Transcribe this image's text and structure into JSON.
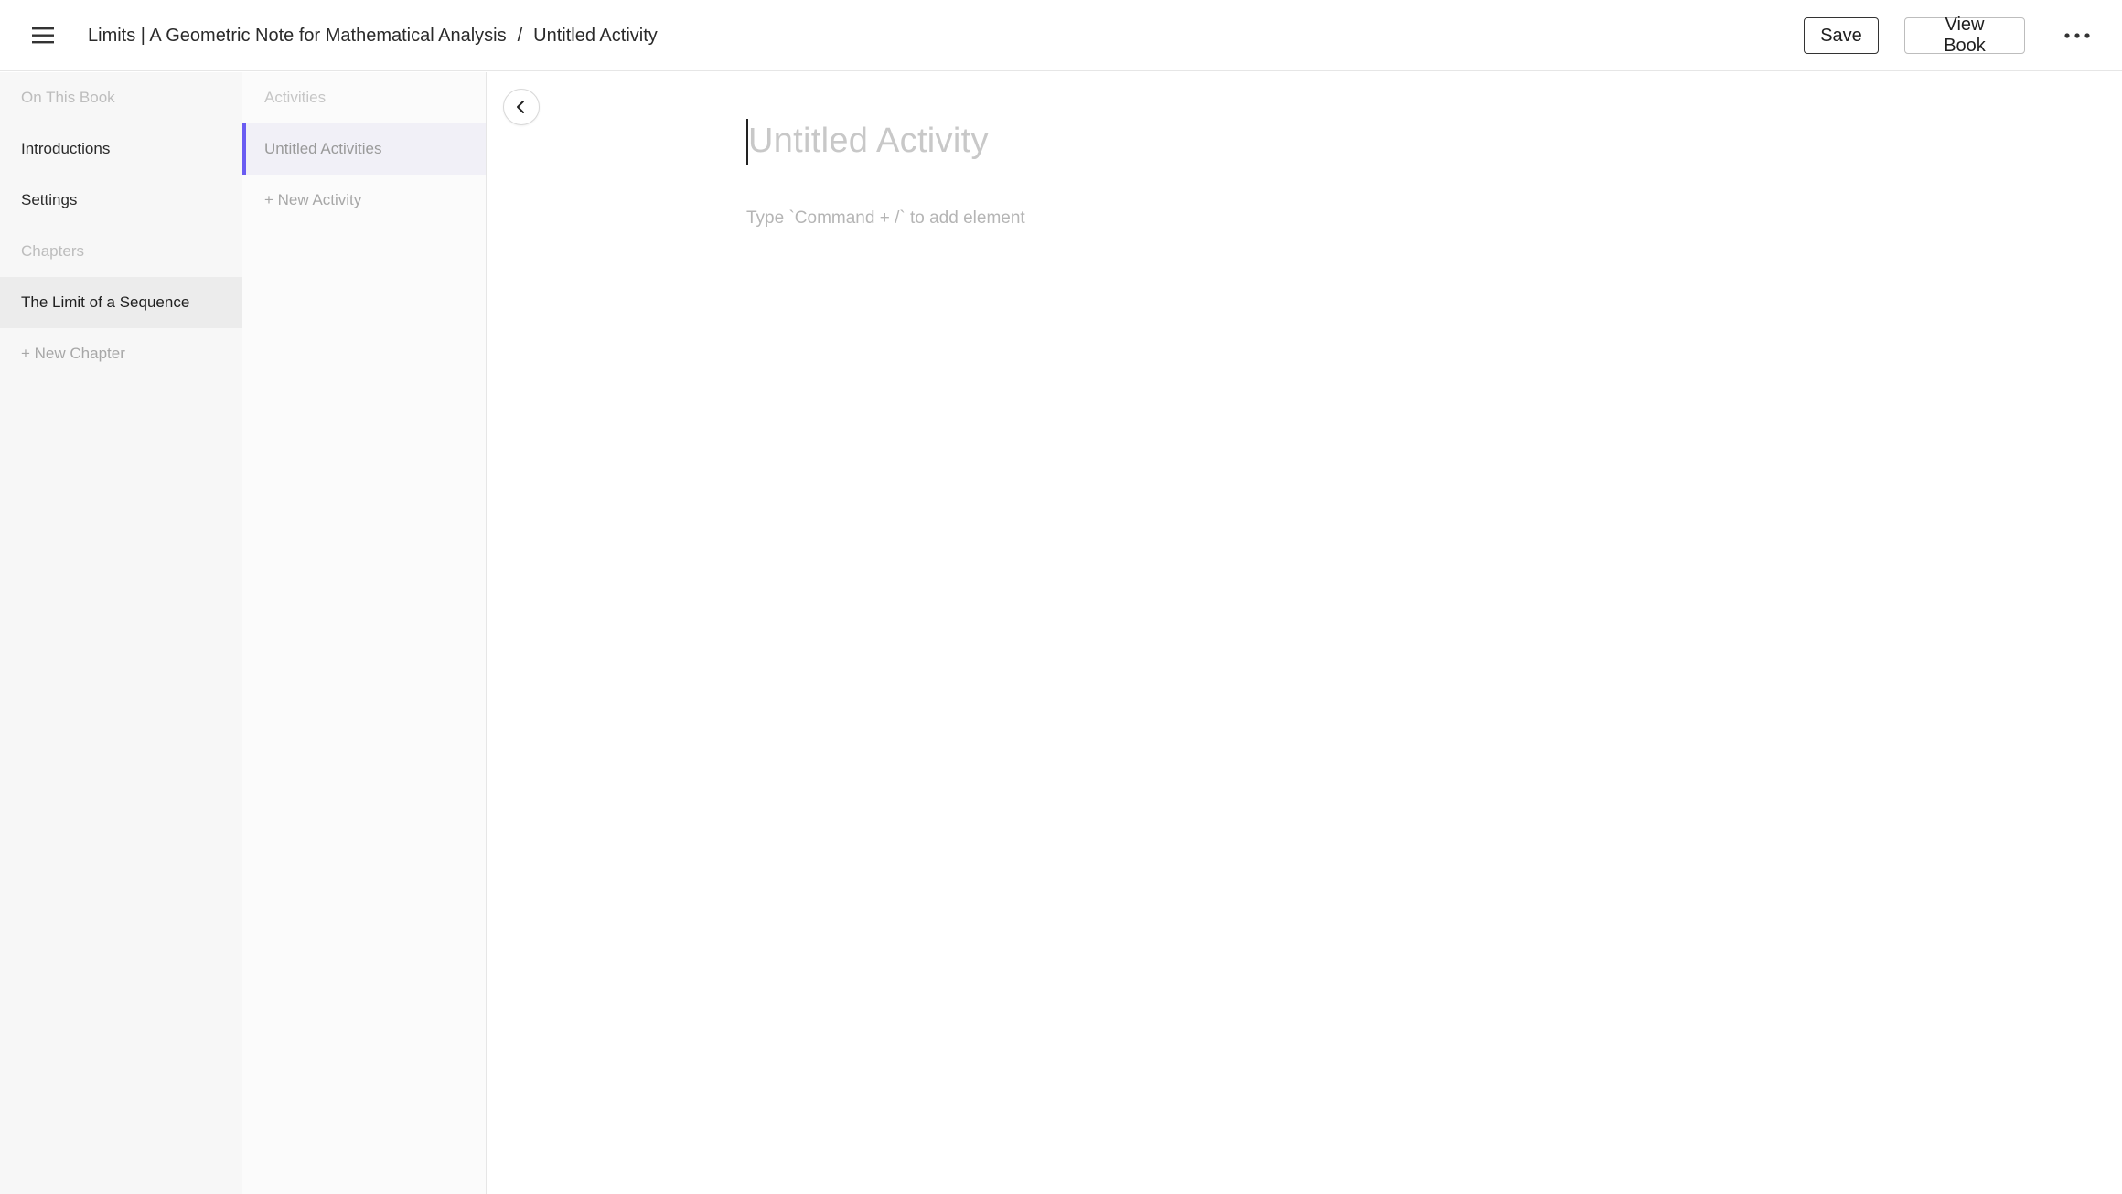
{
  "header": {
    "menu_icon": "hamburger-menu-icon",
    "breadcrumb": {
      "book_title": "Limits | A Geometric Note for Mathematical Analysis",
      "separator": "/",
      "current": "Untitled Activity"
    },
    "save_label": "Save",
    "view_book_label": "View Book",
    "more_icon": "more-horizontal-icon"
  },
  "sidebar": {
    "section_book": "On This Book",
    "items": [
      {
        "label": "Introductions"
      },
      {
        "label": "Settings"
      }
    ],
    "section_chapters": "Chapters",
    "chapters": [
      {
        "label": "The Limit of a Sequence",
        "active": true
      }
    ],
    "add_chapter": "+ New Chapter"
  },
  "activities_panel": {
    "section": "Activities",
    "items": [
      {
        "label": "Untitled Activities",
        "active": true
      }
    ],
    "add_activity": "+ New Activity",
    "collapse_icon": "chevron-left-icon"
  },
  "editor": {
    "title_placeholder": "Untitled Activity",
    "hint": "Type `Command + /` to add element"
  },
  "colors": {
    "accent": "#6a5cf2",
    "sidebar_bg": "#f7f7f7",
    "active_item_bg": "#ececec",
    "placeholder_text": "#c8c8c8"
  }
}
